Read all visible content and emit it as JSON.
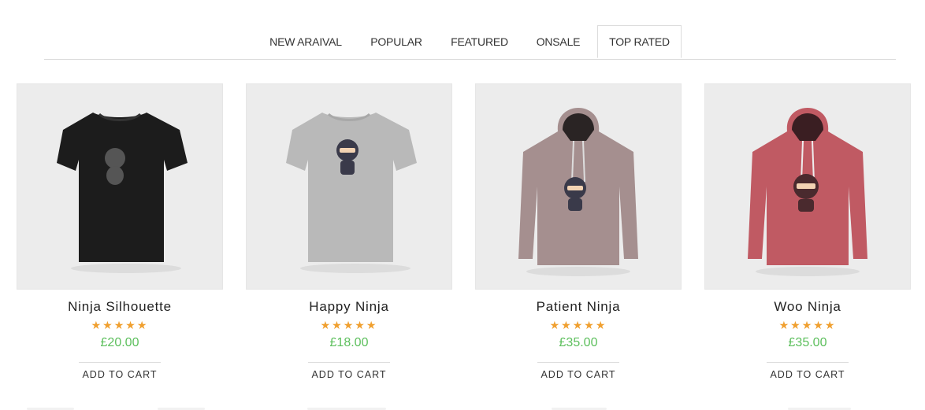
{
  "tabs": [
    {
      "label": "NEW ARAIVAL",
      "active": false
    },
    {
      "label": "POPULAR",
      "active": false
    },
    {
      "label": "FEATURED",
      "active": false
    },
    {
      "label": "ONSALE",
      "active": false
    },
    {
      "label": "TOP RATED",
      "active": true
    }
  ],
  "products": [
    {
      "name": "Ninja Silhouette",
      "rating": 5,
      "stars": "★★★★★",
      "price": "£20.00",
      "cta": "ADD TO CART",
      "garment": "tshirt",
      "color": "#1c1c1c",
      "icon": "ninja-silhouette-tshirt-image"
    },
    {
      "name": "Happy Ninja",
      "rating": 5,
      "stars": "★★★★★",
      "price": "£18.00",
      "cta": "ADD TO CART",
      "garment": "tshirt",
      "color": "#b9b9b9",
      "icon": "happy-ninja-tshirt-image"
    },
    {
      "name": "Patient Ninja",
      "rating": 5,
      "stars": "★★★★★",
      "price": "£35.00",
      "cta": "ADD TO CART",
      "garment": "hoodie",
      "color": "#a58f8f",
      "icon": "patient-ninja-hoodie-image"
    },
    {
      "name": "Woo Ninja",
      "rating": 5,
      "stars": "★★★★★",
      "price": "£35.00",
      "cta": "ADD TO CART",
      "garment": "hoodie",
      "color": "#c05a63",
      "icon": "woo-ninja-hoodie-image"
    }
  ],
  "colors": {
    "star": "#f0a030",
    "price": "#5cbf5c",
    "divider": "#dcdcdc",
    "photo_bg": "#ececec"
  }
}
